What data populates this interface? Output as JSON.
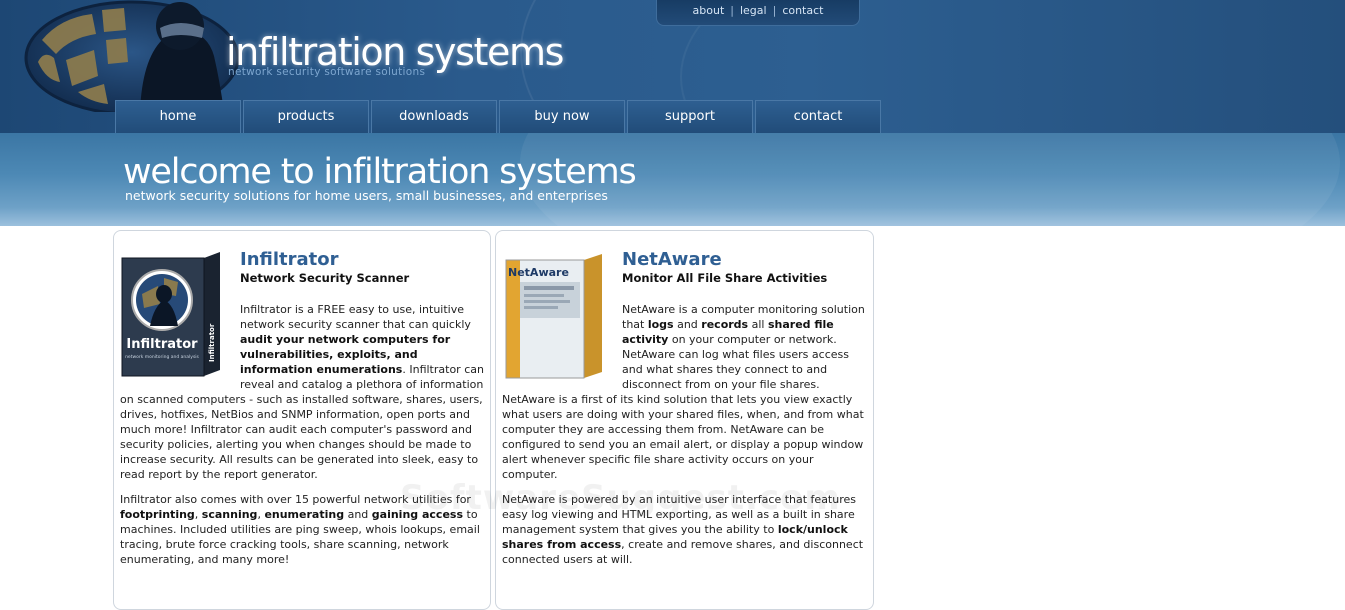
{
  "header": {
    "title": "infiltration systems",
    "tagline": "network security software solutions",
    "top_links": [
      {
        "label": "about"
      },
      {
        "label": "legal"
      },
      {
        "label": "contact"
      }
    ],
    "nav": [
      {
        "label": "home"
      },
      {
        "label": "products"
      },
      {
        "label": "downloads"
      },
      {
        "label": "buy now"
      },
      {
        "label": "support"
      },
      {
        "label": "contact"
      }
    ]
  },
  "banner": {
    "title": "welcome to infiltration systems",
    "subtitle": "network security solutions for home users, small businesses, and enterprises"
  },
  "infiltrator": {
    "name": "Infiltrator",
    "subtitle": "Network Security Scanner",
    "box_label": "Infiltrator",
    "box_side": "Infiltrator",
    "box_sub": "network monitoring and analysis",
    "p1_a": "Infiltrator is a FREE easy to use, intuitive network security scanner that can quickly ",
    "p1_b1": "audit your network computers for vulnerabilities, exploits, and information enumerations",
    "p1_c": ". Infiltrator can reveal and catalog a plethora of information on scanned computers - such as installed software, shares, users, drives, hotfixes, NetBios and SNMP information, open ports and much more! Infiltrator can audit each computer's password and security policies, alerting you when changes should be made to increase security. All results can be generated into sleek, easy to read report by the report generator.",
    "p2_a": "Infiltrator also comes with over 15 powerful network utilities for ",
    "p2_b1": "footprinting",
    "p2_s1": ", ",
    "p2_b2": "scanning",
    "p2_s2": ", ",
    "p2_b3": "enumerating",
    "p2_s3": " and ",
    "p2_b4": "gaining access",
    "p2_c": " to machines. Included utilities are ping sweep, whois lookups, email tracing, brute force cracking tools, share scanning, network enumerating, and many more!"
  },
  "netaware": {
    "name": "NetAware",
    "subtitle": "Monitor All File Share Activities",
    "box_label": "NetAware",
    "p1_a": "NetAware is a computer monitoring solution that ",
    "p1_b1": "logs",
    "p1_s1": " and ",
    "p1_b2": "records",
    "p1_s2": " all ",
    "p1_b3": "shared file activity",
    "p1_c": " on your computer or network. NetAware can log what files users access and what shares they connect to and disconnect from on your file shares. NetAware is a first of its kind solution that lets you view exactly what users are doing with your shared files, when, and from what computer they are accessing them from. NetAware can be configured to send you an email alert, or display a popup window alert whenever specific file share activity occurs on your computer.",
    "p2_a": "NetAware is powered by an intuitive user interface that features easy log viewing and HTML exporting, as well as a built in share management system that gives you the ability to ",
    "p2_b1": "lock/unlock shares from access",
    "p2_c": ", create and remove shares, and disconnect connected users at will."
  },
  "watermark": "SoftwareSuggest.com",
  "colors": {
    "header_bg": "#2a5a8c",
    "banner_bg": "#4d89b5",
    "heading": "#2f5f93",
    "panel_border": "#cfd6de"
  }
}
